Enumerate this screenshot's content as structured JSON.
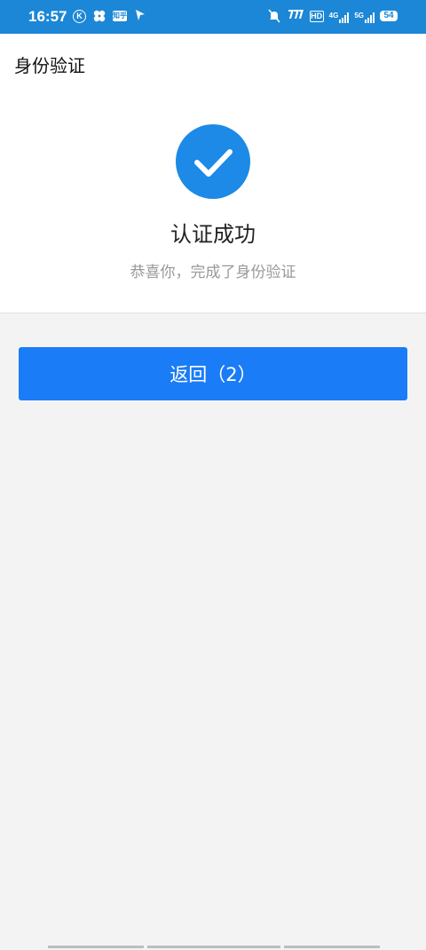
{
  "status_bar": {
    "time": "16:57",
    "left_icons": [
      "k-circle-icon",
      "fan-icon",
      "zhihu-icon",
      "location-arrow-icon"
    ],
    "zhihu_label": "知乎",
    "k_label": "K",
    "signal_labels": [
      "HD",
      "4G",
      "5G"
    ],
    "battery": "54",
    "colors": {
      "background": "#1c87d6"
    }
  },
  "header": {
    "title": "身份验证"
  },
  "result": {
    "title": "认证成功",
    "subtitle": "恭喜你，完成了身份验证",
    "icon": "check-circle-icon",
    "icon_color": "#1c8ae6"
  },
  "actions": {
    "back_label": "返回（2）",
    "back_color": "#1a7cf6"
  }
}
